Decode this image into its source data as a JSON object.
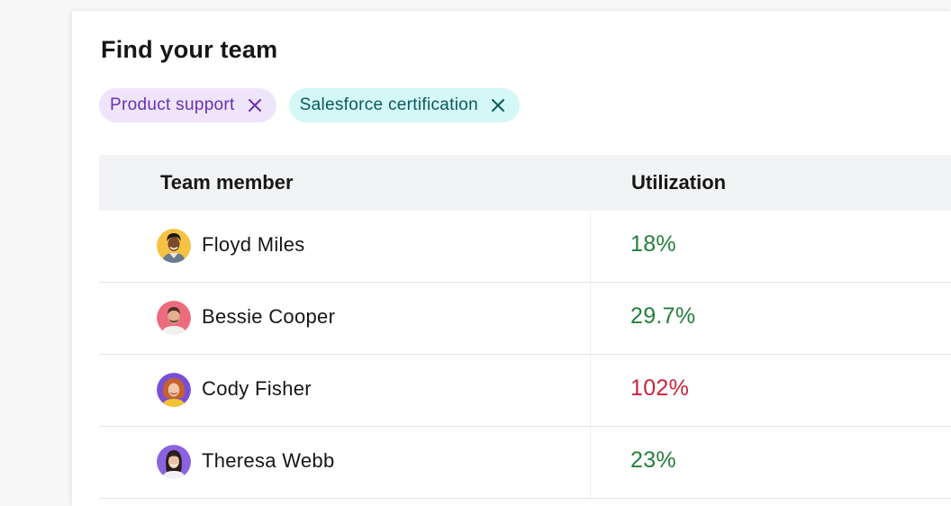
{
  "panel": {
    "title": "Find your team"
  },
  "filters": [
    {
      "label": "Product support",
      "remove_icon": "close-icon"
    },
    {
      "label": "Salesforce certification",
      "remove_icon": "close-icon"
    }
  ],
  "table": {
    "columns": {
      "member": "Team member",
      "utilization": "Utilization"
    },
    "rows": [
      {
        "name": "Floyd Miles",
        "utilization": "18%",
        "status": "ok"
      },
      {
        "name": "Bessie Cooper",
        "utilization": "29.7%",
        "status": "ok"
      },
      {
        "name": "Cody Fisher",
        "utilization": "102%",
        "status": "over"
      },
      {
        "name": "Theresa Webb",
        "utilization": "23%",
        "status": "ok"
      }
    ]
  },
  "colors": {
    "ok": "#24803a",
    "over": "#c9233a",
    "tag_purple_bg": "#eee5fb",
    "tag_teal_bg": "#d4f7f7"
  }
}
